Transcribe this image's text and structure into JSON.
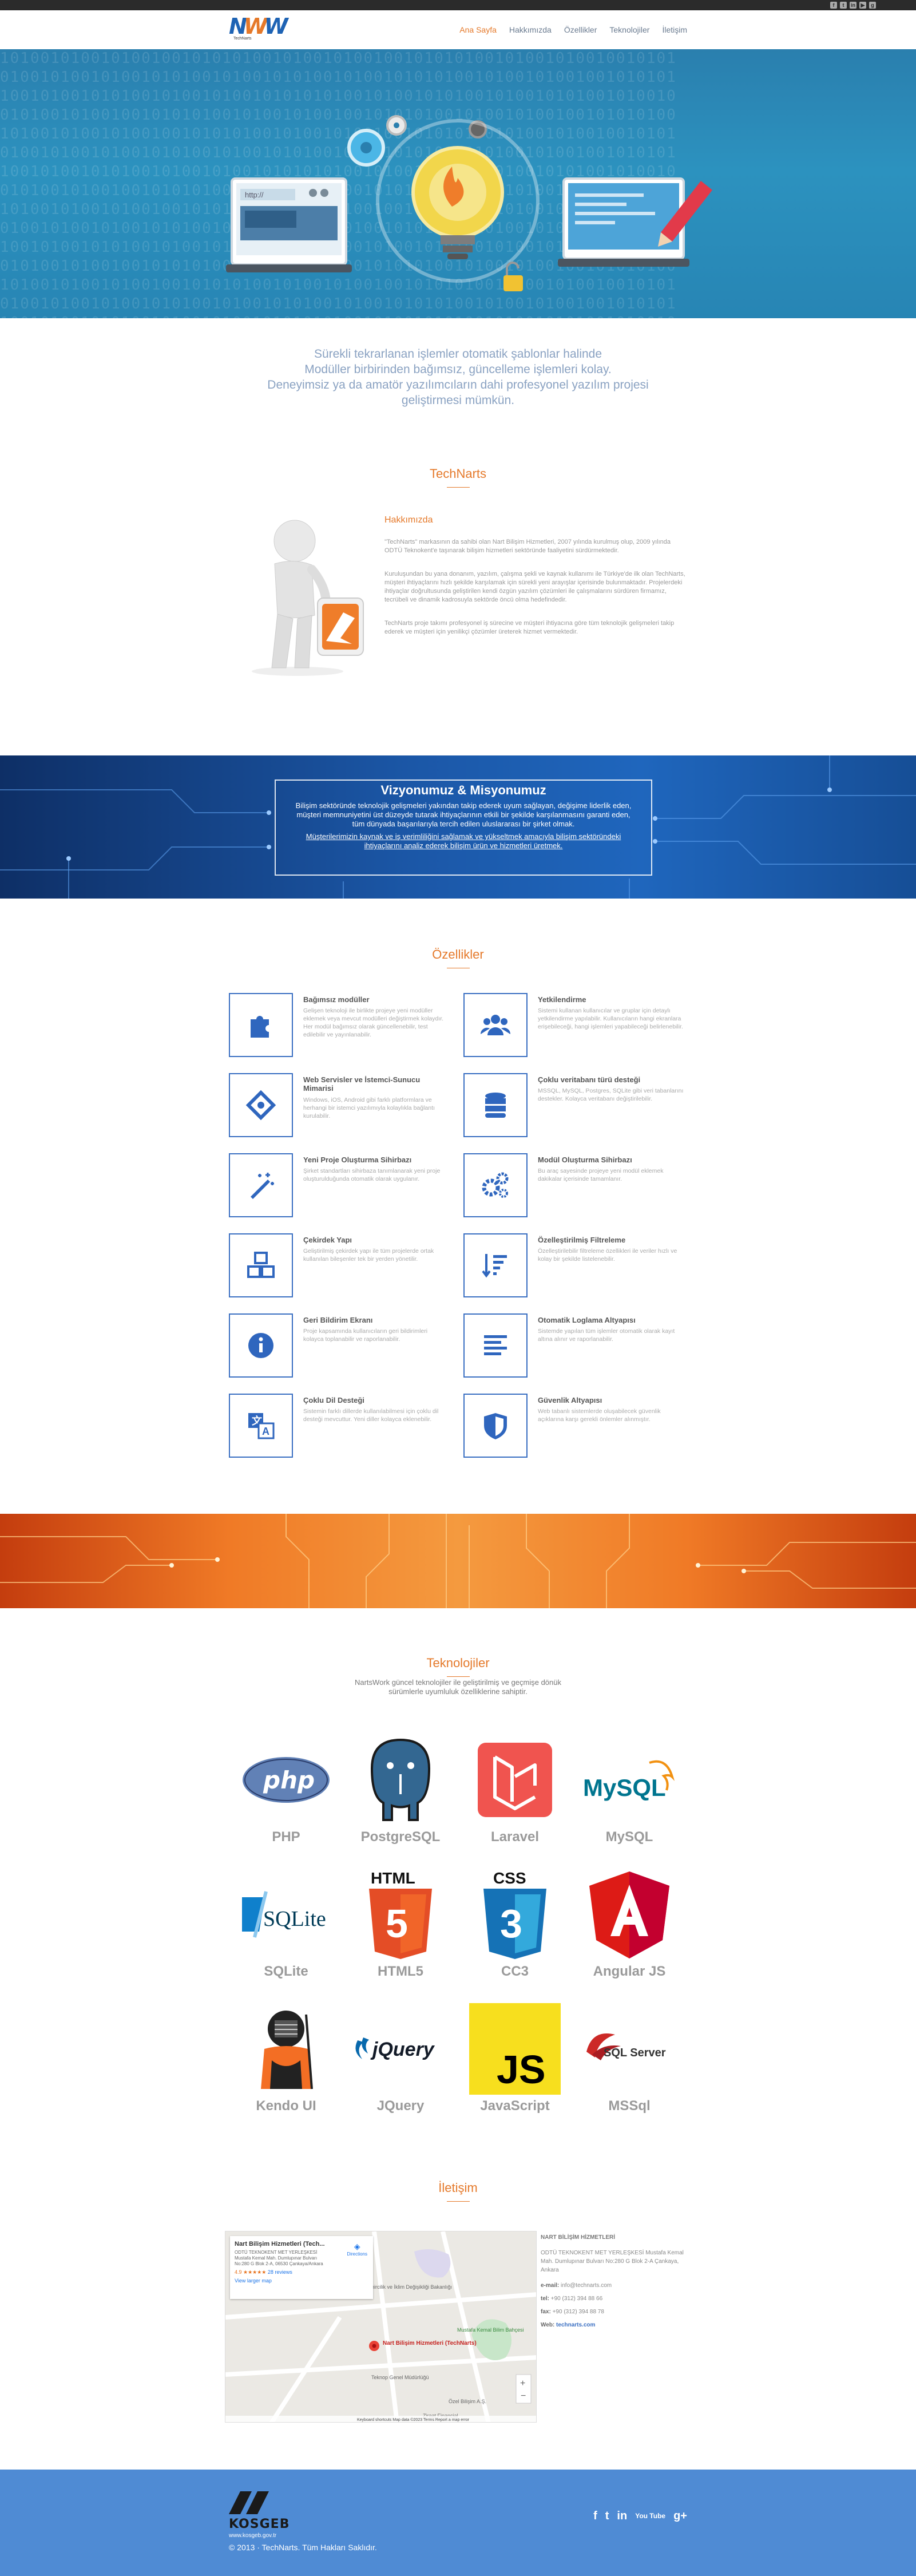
{
  "header": {
    "logo_tagline": "TechNarts",
    "nav": [
      {
        "label": "Ana Sayfa",
        "active": true
      },
      {
        "label": "Hakkımızda",
        "active": false
      },
      {
        "label": "Özellikler",
        "active": false
      },
      {
        "label": "Teknolojiler",
        "active": false
      },
      {
        "label": "İletişim",
        "active": false
      }
    ],
    "top_social": [
      "facebook-icon",
      "twitter-icon",
      "linkedin-icon",
      "youtube-icon",
      "google-plus-icon"
    ]
  },
  "intro": {
    "lines": [
      "Sürekli tekrarlanan işlemler otomatik şablonlar halinde",
      "Modüller birbirinden bağımsız, güncelleme işlemleri kolay.",
      "Deneyimsiz ya da amatör yazılımcıların dahi profesyonel yazılım projesi",
      "geliştirmesi mümkün."
    ]
  },
  "about": {
    "section_title": "TechNarts",
    "heading": "Hakkımızda",
    "paragraphs": [
      "\"TechNarts\" markasının da sahibi olan Nart Bilişim Hizmetleri, 2007 yılında kurulmuş olup, 2009 yılında ODTÜ Teknokent'e taşınarak bilişim hizmetleri sektöründe faaliyetini sürdürmektedir.",
      "Kuruluşundan bu yana donanım, yazılım, çalışma şekli ve kaynak kullanımı ile Türkiye'de ilk olan TechNarts, müşteri ihtiyaçlarını hızlı şekilde karşılamak için sürekli yeni arayışlar içerisinde bulunmaktadır. Projelerdeki ihtiyaçlar doğrultusunda geliştirilen kendi özgün yazılım çözümleri ile çalışmalarını sürdüren firmamız, tecrübeli ve dinamik kadrosuyla sektörde öncü olma hedefindedir.",
      "TechNarts proje takımı profesyonel iş sürecine ve müşteri ihtiyacına göre tüm teknolojik gelişmeleri takip ederek ve müşteri için yenilikçi çözümler üreterek hizmet vermektedir."
    ]
  },
  "vision": {
    "title": "Vizyonumuz & Misyonumuz",
    "text1": "Bilişim sektöründe teknolojik gelişmeleri yakından takip ederek uyum sağlayan, değişime liderlik eden, müşteri memnuniyetini üst düzeyde tutarak ihtiyaçlarının etkili bir şekilde karşılanmasını garanti eden, tüm dünyada başarılarıyla tercih edilen uluslararası bir şirket olmak.",
    "text2": "Müşterilerimizin kaynak ve iş verimliliğini sağlamak ve yükseltmek amacıyla bilişim sektöründeki ihtiyaçlarını analiz ederek bilişim ürün ve hizmetleri üretmek."
  },
  "features": {
    "section_title": "Özellikler",
    "items": [
      {
        "icon": "puzzle-icon",
        "title": "Bağımsız modüller",
        "text": "Gelişen teknoloji ile birlikte projeye yeni modüller eklemek veya mevcut modülleri değiştirmek kolaydır. Her modül bağımsız olarak güncellenebilir, test edilebilir ve yayınlanabilir."
      },
      {
        "icon": "users-icon",
        "title": "Yetkilendirme",
        "text": "Sistemi kullanan kullanıcılar ve gruplar için detaylı yetkilendirme yapılabilir. Kullanıcıların hangi ekranlara erişebileceği, hangi işlemleri yapabileceği belirlenebilir."
      },
      {
        "icon": "api-icon",
        "title": "Web Servisler ve İstemci-Sunucu Mimarisi",
        "text": "Windows, iOS, Android gibi farklı platformlara ve herhangi bir istemci yazılımıyla kolaylıkla bağlantı kurulabilir."
      },
      {
        "icon": "database-icon",
        "title": "Çoklu veritabanı türü desteği",
        "text": "MSSQL, MySQL, Postgres, SQLite gibi veri tabanlarını destekler. Kolayca veritabanı değiştirilebilir."
      },
      {
        "icon": "wand-icon",
        "title": "Yeni Proje Oluşturma Sihirbazı",
        "text": "Şirket standartları sihirbaza tanımlanarak yeni proje oluşturulduğunda otomatik olarak uygulanır."
      },
      {
        "icon": "cogs-icon",
        "title": "Modül Oluşturma Sihirbazı",
        "text": "Bu araç sayesinde projeye yeni modül eklemek dakikalar içerisinde tamamlanır."
      },
      {
        "icon": "cubes-icon",
        "title": "Çekirdek Yapı",
        "text": "Geliştirilmiş çekirdek yapı ile tüm projelerde ortak kullanılan bileşenler tek bir yerden yönetilir."
      },
      {
        "icon": "filter-icon",
        "title": "Özelleştirilmiş Filtreleme",
        "text": "Özelleştirilebilir filtreleme özellikleri ile veriler hızlı ve kolay bir şekilde listelenebilir."
      },
      {
        "icon": "info-icon",
        "title": "Geri Bildirim Ekranı",
        "text": "Proje kapsamında kullanıcıların geri bildirimleri kolayca toplanabilir ve raporlanabilir."
      },
      {
        "icon": "list-icon",
        "title": "Otomatik Loglama Altyapısı",
        "text": "Sistemde yapılan tüm işlemler otomatik olarak kayıt altına alınır ve raporlanabilir."
      },
      {
        "icon": "translate-icon",
        "title": "Çoklu Dil Desteği",
        "text": "Sistemin farklı dillerde kullanılabilmesi için çoklu dil desteği mevcuttur. Yeni diller kolayca eklenebilir."
      },
      {
        "icon": "shield-icon",
        "title": "Güvenlik Altyapısı",
        "text": "Web tabanlı sistemlerde oluşabilecek güvenlik açıklarına karşı gerekli önlemler alınmıştır."
      }
    ]
  },
  "technologies": {
    "section_title": "Teknolojiler",
    "subtitle_lines": [
      "NartsWork güncel teknolojiler ile geliştirilmiş ve geçmişe dönük",
      "sürümlerle uyumluluk özelliklerine sahiptir."
    ],
    "items": [
      {
        "name": "PHP",
        "logo": "php-logo-icon"
      },
      {
        "name": "PostgreSQL",
        "logo": "postgresql-logo-icon"
      },
      {
        "name": "Laravel",
        "logo": "laravel-logo-icon"
      },
      {
        "name": "MySQL",
        "logo": "mysql-logo-icon"
      },
      {
        "name": "SQLite",
        "logo": "sqlite-logo-icon"
      },
      {
        "name": "HTML5",
        "logo": "html5-logo-icon"
      },
      {
        "name": "CC3",
        "logo": "css3-logo-icon"
      },
      {
        "name": "Angular JS",
        "logo": "angular-logo-icon"
      },
      {
        "name": "Kendo UI",
        "logo": "kendo-logo-icon"
      },
      {
        "name": "JQuery",
        "logo": "jquery-logo-icon"
      },
      {
        "name": "JavaScript",
        "logo": "javascript-logo-icon"
      },
      {
        "name": "MSSql",
        "logo": "mssql-logo-icon"
      }
    ],
    "logo_text": {
      "php": "php",
      "html": "HTML",
      "css": "CSS",
      "js": "JS",
      "sqlite": "SQLite",
      "jquery": "jQuery",
      "mysql": "MySQL",
      "sqlserver": "SQL Server"
    }
  },
  "contact": {
    "section_title": "İletişim",
    "map": {
      "place_name": "Nart Bilişim Hizmetleri (Tech...",
      "address": "ODTÜ TEKNOKENT MET YERLEŞKESİ Mustafa Kemal Mah. Dumlupınar Bulvarı No:280 G Blok 2-A, 06530 Çankaya/Ankara",
      "rating": "4.9 ★★★★★",
      "reviews": "28 reviews",
      "larger_map": "View larger map",
      "directions": "Directions",
      "pin_label": "Nart Bilişim Hizmetleri (TechNarts)",
      "poi": [
        "Mustafa Kemal Bilim Bahçesi",
        "Teknop Genel Müdürlüğü",
        "Çevre, Şehircilik ve İklim Değişikliği Bakanlığı",
        "Ziraat Financial",
        "Özel Bilişim A.Ş."
      ],
      "footer": "Keyboard shortcuts   Map data ©2023   Terms   Report a map error"
    },
    "company": "NART BİLİŞİM HİZMETLERİ",
    "address": "ODTÜ TEKNOKENT MET YERLEŞKESİ Mustafa Kemal Mah. Dumlupınar Bulvarı No:280 G Blok 2-A Çankaya, Ankara",
    "email_label": "e-mail:",
    "email": "info@technarts.com",
    "tel_label": "tel:",
    "tel": "+90 (312) 394 88 66",
    "fax_label": "fax:",
    "fax": "+90 (312) 394 88 78",
    "web_label": "Web:",
    "web": "technarts.com"
  },
  "footer": {
    "kosgeb": "KOSGEB",
    "kosgeb_url": "www.kosgeb.gov.tr",
    "copyright": "© 2013 · TechNarts. Tüm Hakları Saklıdır.",
    "social": [
      "f",
      "t",
      "in",
      "You Tube",
      "g+"
    ]
  },
  "colors": {
    "accent": "#e5792a",
    "primary": "#3a6fc2",
    "footer": "#4f8bd4"
  }
}
